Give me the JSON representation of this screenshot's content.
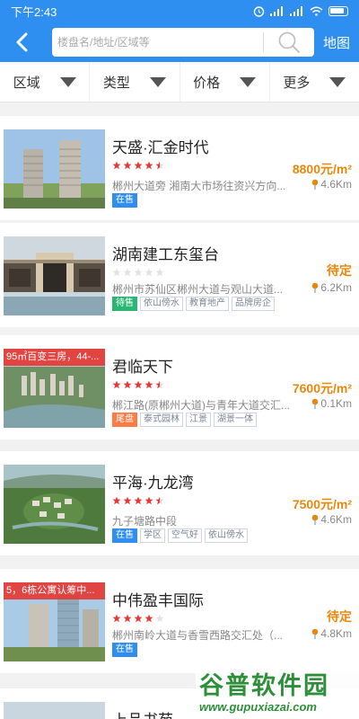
{
  "status": {
    "time": "下午2:43"
  },
  "nav": {
    "back_icon": "back-arrow-icon",
    "search_placeholder": "楼盘名/地址/区域等",
    "map_label": "地图"
  },
  "filters": [
    {
      "label": "区域"
    },
    {
      "label": "类型"
    },
    {
      "label": "价格"
    },
    {
      "label": "更多"
    }
  ],
  "listings": [
    {
      "name": "天盛·汇金时代",
      "price": "8800元/m²",
      "address": "郴州大道旁 湘南大市场往资兴方向...",
      "distance": "4.6Km",
      "rating": 4.5,
      "promo": "",
      "tags": [
        "在售"
      ]
    },
    {
      "name": "湖南建工东玺台",
      "price": "待定",
      "address": "郴州市苏仙区郴州大道与观山大道...",
      "distance": "6.2Km",
      "rating": 0,
      "promo": "",
      "tags": [
        "待售",
        "依山傍水",
        "教育地产",
        "品牌房企"
      ]
    },
    {
      "name": "君临天下",
      "price": "7600元/m²",
      "address": "郴江路(原郴州大道)与青年大道交汇...",
      "distance": "0.1Km",
      "rating": 4.5,
      "promo": "95㎡百变三房，44-...",
      "tags": [
        "尾盘",
        "泰式园林",
        "江景",
        "湖景一体"
      ]
    },
    {
      "name": "平海·九龙湾",
      "price": "7500元/m²",
      "address": "九子塘路中段",
      "distance": "4.6Km",
      "rating": 4.5,
      "promo": "",
      "tags": [
        "在售",
        "学区",
        "空气好",
        "依山傍水"
      ]
    },
    {
      "name": "中伟盈丰国际",
      "price": "待定",
      "address": "郴州南岭大道与香雪西路交汇处（...",
      "distance": "4.8Km",
      "rating": 4,
      "promo": "5，6栋公寓认筹中...",
      "tags": [
        "在售"
      ]
    },
    {
      "name": "上品书苑"
    }
  ],
  "watermark": {
    "title": "谷普软件园",
    "url": "www.gupuxiazai.com"
  },
  "colors": {
    "primary": "#2f8ff0",
    "price": "#e8870e",
    "star": "#e53935",
    "promo": "#e53935"
  }
}
